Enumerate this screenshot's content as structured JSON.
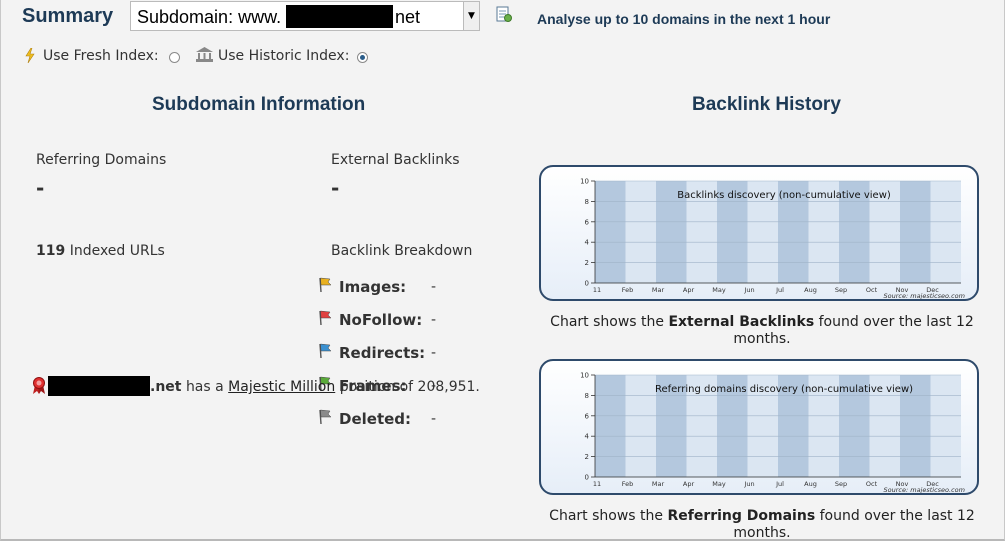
{
  "header": {
    "title": "Summary",
    "subdomain_select": {
      "prefix": "Subdomain: www.",
      "suffix": "net"
    },
    "analyse_text": "Analyse up to 10 domains in the next 1 hour",
    "analyse_icon": "report-icon"
  },
  "index_options": {
    "fresh": {
      "label": "Use Fresh Index:",
      "icon": "lightning-icon",
      "checked": false
    },
    "historic": {
      "label": "Use Historic Index:",
      "icon": "bank-building-icon",
      "checked": true
    }
  },
  "subdomain_info": {
    "heading": "Subdomain Information",
    "referring_domains": {
      "label": "Referring Domains",
      "value": "-"
    },
    "external_backlinks": {
      "label": "External Backlinks",
      "value": "-"
    },
    "indexed_urls": {
      "count": "119",
      "label": "Indexed URLs"
    },
    "breakdown": {
      "label": "Backlink Breakdown",
      "items": [
        {
          "label": "Images:",
          "value": "-",
          "icon": "flag-yellow-icon",
          "color": "#e8b020"
        },
        {
          "label": "NoFollow:",
          "value": "-",
          "icon": "flag-red-icon",
          "color": "#e04040"
        },
        {
          "label": "Redirects:",
          "value": "-",
          "icon": "flag-blue-icon",
          "color": "#3a90d0"
        },
        {
          "label": "Frames:",
          "value": "-",
          "icon": "flag-green-icon",
          "color": "#5aaa3a"
        },
        {
          "label": "Deleted:",
          "value": "-",
          "icon": "flag-grey-icon",
          "color": "#8a8a8a"
        }
      ]
    },
    "majestic": {
      "icon": "award-ribbon-icon",
      "domain_suffix": ".net",
      "text_before": "has a",
      "link": "Majestic Million",
      "text_after": "position of 208,951."
    }
  },
  "backlink_history": {
    "heading": "Backlink History",
    "charts": [
      {
        "caption_pre": "Chart shows the",
        "caption_bold": "External Backlinks",
        "caption_post": "found over the last 12 months.",
        "chart_data": {
          "type": "bar",
          "title": "Backlinks discovery (non-cumulative view)",
          "categories": [
            "11",
            "Feb",
            "Mar",
            "Apr",
            "May",
            "Jun",
            "Jul",
            "Aug",
            "Sep",
            "Oct",
            "Nov",
            "Dec"
          ],
          "values": [],
          "ylim": [
            0,
            10
          ],
          "yticks": [
            0,
            2,
            4,
            6,
            8,
            10
          ],
          "source": "Source: majesticseo.com"
        }
      },
      {
        "caption_pre": "Chart shows the",
        "caption_bold": "Referring Domains",
        "caption_post": "found over the last 12 months.",
        "chart_data": {
          "type": "bar",
          "title": "Referring domains discovery (non-cumulative view)",
          "categories": [
            "11",
            "Feb",
            "Mar",
            "Apr",
            "May",
            "Jun",
            "Jul",
            "Aug",
            "Sep",
            "Oct",
            "Nov",
            "Dec"
          ],
          "values": [],
          "ylim": [
            0,
            10
          ],
          "yticks": [
            0,
            2,
            4,
            6,
            8,
            10
          ],
          "source": "Source: majesticseo.com"
        }
      }
    ]
  }
}
